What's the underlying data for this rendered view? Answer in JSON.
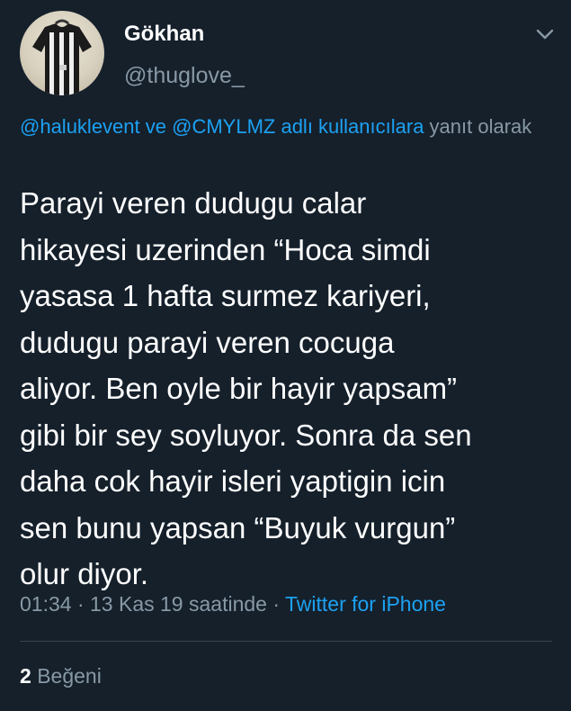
{
  "tweet": {
    "author": {
      "display_name": "Gökhan",
      "handle": "@thuglove_",
      "avatar_icon": "jersey-avatar"
    },
    "reply_context": {
      "mentions": [
        "@haluklevent",
        "@CMYLMZ"
      ],
      "connector": " ve ",
      "suffix_link": " adlı kullanıcılara",
      "suffix_text": " yanıt olarak"
    },
    "text": "Parayi veren dudugu calar\nhikayesi uzerinden “Hoca simdi\nyasasa 1 hafta surmez kariyeri,\ndudugu parayi veren cocuga\naliyor. Ben oyle bir hayir yapsam”\ngibi bir sey soyluyor. Sonra da sen\ndaha cok hayir isleri yaptigin icin\nsen bunu yapsan “Buyuk vurgun”\nolur diyor.",
    "time": "01:34",
    "date_text": "13 Kas 19 saatinde",
    "separator": "·",
    "source": "Twitter for iPhone",
    "likes_count": "2",
    "likes_label": "Beğeni"
  },
  "colors": {
    "background": "#15202b",
    "text_primary": "#ffffff",
    "text_secondary": "#8899a6",
    "link": "#1da1f2",
    "divider": "#38444d"
  }
}
